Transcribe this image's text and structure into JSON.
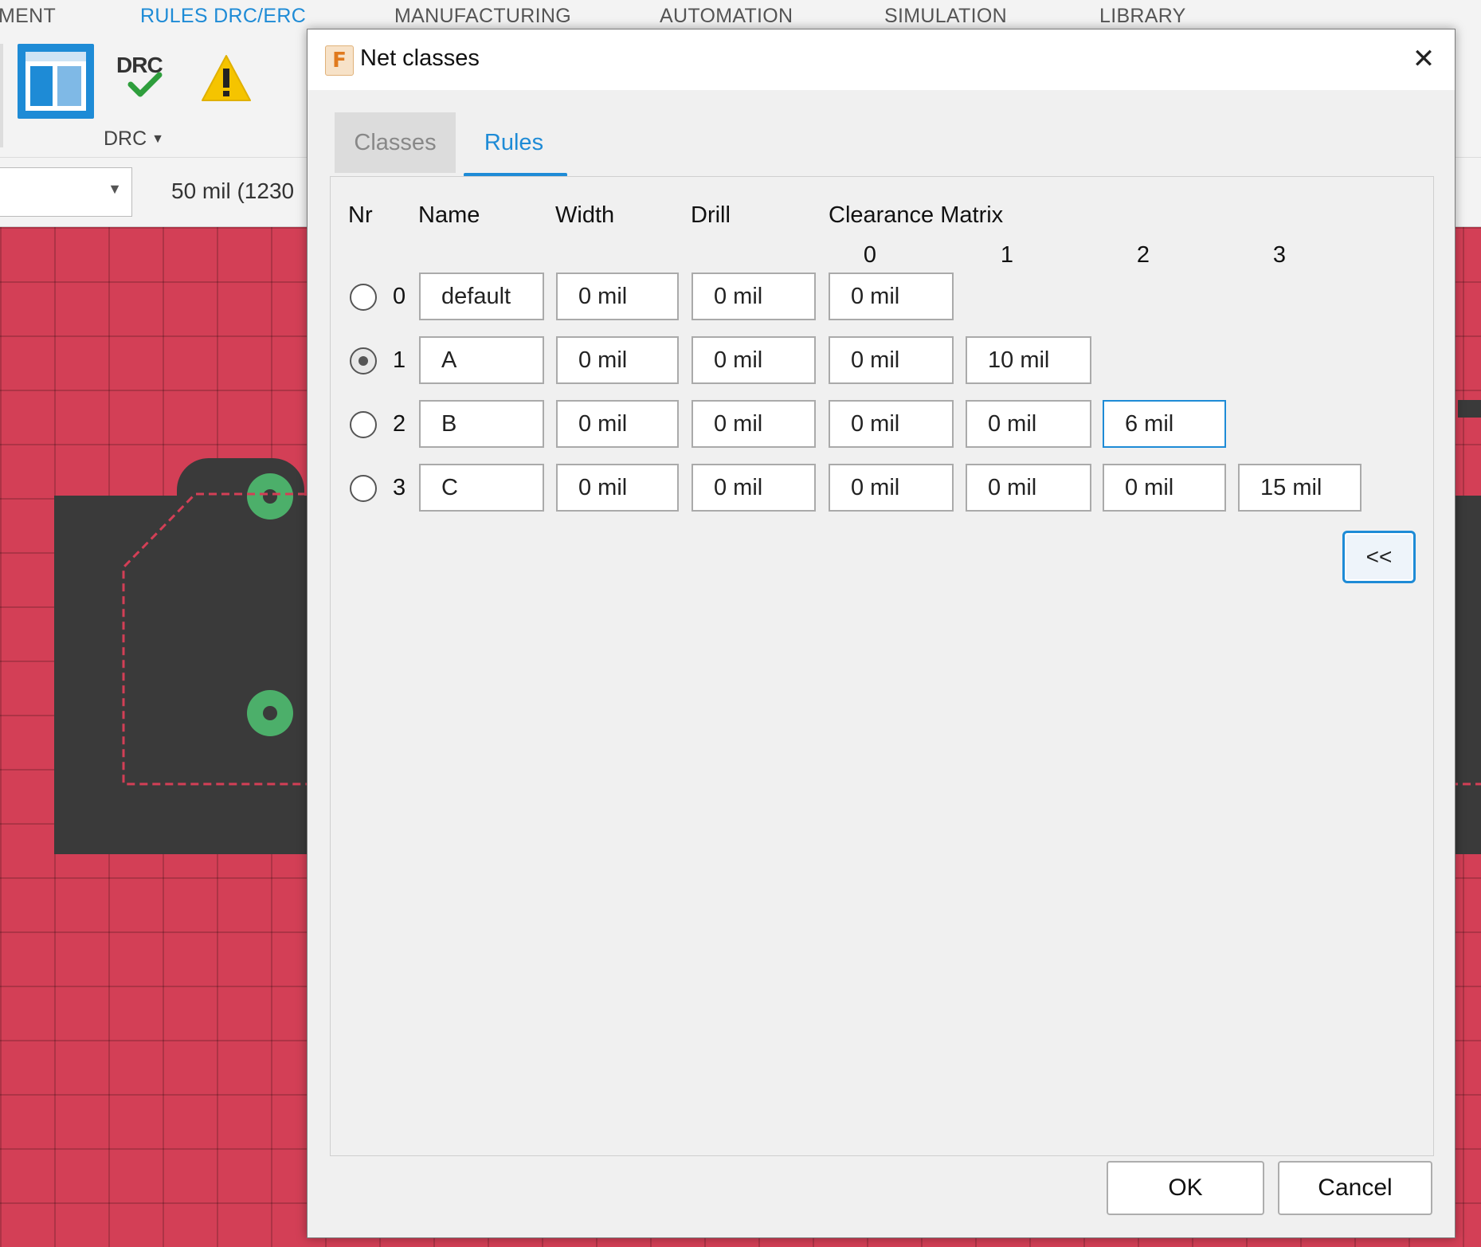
{
  "ribbon": {
    "tabs": [
      {
        "label": "MENT",
        "active": false
      },
      {
        "label": "RULES DRC/ERC",
        "active": true
      },
      {
        "label": "MANUFACTURING",
        "active": false
      },
      {
        "label": "AUTOMATION",
        "active": false
      },
      {
        "label": "SIMULATION",
        "active": false
      },
      {
        "label": "LIBRARY",
        "active": false
      }
    ],
    "drc_icon_text": "DRC",
    "drc_dropdown_label": "DRC",
    "grid_text": "50 mil (1230"
  },
  "colors": {
    "accent": "#1e8bd6",
    "canvas": "#d33f56",
    "board": "#3a3a3a",
    "pad": "#4caf6a"
  },
  "dialog": {
    "logo_letter": "F",
    "title": "Net classes",
    "close_glyph": "✕",
    "tabs": {
      "classes": "Classes",
      "rules": "Rules"
    },
    "active_tab": "rules",
    "headers": {
      "nr": "Nr",
      "name": "Name",
      "width": "Width",
      "drill": "Drill",
      "clearance_matrix": "Clearance Matrix"
    },
    "matrix_columns": [
      "0",
      "1",
      "2",
      "3"
    ],
    "rows": [
      {
        "nr": "0",
        "name": "default",
        "width": "0 mil",
        "drill": "0 mil",
        "clearance": [
          "0 mil"
        ],
        "selected": false
      },
      {
        "nr": "1",
        "name": "A",
        "width": "0 mil",
        "drill": "0 mil",
        "clearance": [
          "0 mil",
          "10 mil"
        ],
        "selected": true
      },
      {
        "nr": "2",
        "name": "B",
        "width": "0 mil",
        "drill": "0 mil",
        "clearance": [
          "0 mil",
          "0 mil",
          "6 mil"
        ],
        "selected": false
      },
      {
        "nr": "3",
        "name": "C",
        "width": "0 mil",
        "drill": "0 mil",
        "clearance": [
          "0 mil",
          "0 mil",
          "0 mil",
          "15 mil"
        ],
        "selected": false
      }
    ],
    "focused_cell": {
      "row": 2,
      "col": 2
    },
    "collapse_label": "<<",
    "ok_label": "OK",
    "cancel_label": "Cancel"
  }
}
